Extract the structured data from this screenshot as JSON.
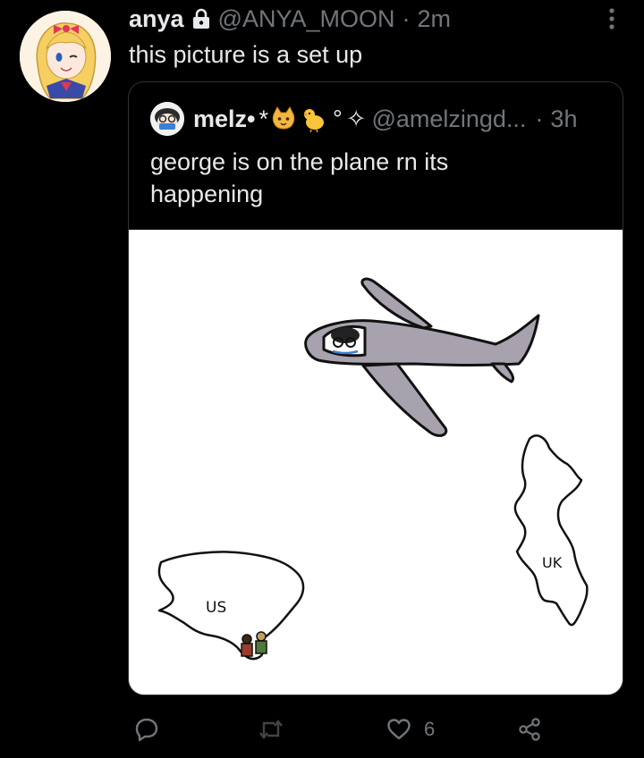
{
  "tweet": {
    "author_name": "anya",
    "author_handle": "@ANYA_MOON",
    "separator": "·",
    "timestamp": "2m",
    "text": "this picture is a set up"
  },
  "quoted_tweet": {
    "author_name": "melz•",
    "name_decoration_star": "*",
    "name_decoration_ring": "°",
    "name_decoration_sparkle": "✧",
    "author_handle": "@amelzingd...",
    "separator": "·",
    "timestamp": "3h",
    "text": "george is on the plane rn its happening",
    "image": {
      "label_us": "US",
      "label_uk": "UK"
    }
  },
  "actions": {
    "reply_icon": "reply-icon",
    "retweet_icon": "retweet-icon",
    "like_icon": "heart-icon",
    "like_count": "6",
    "share_icon": "share-icon"
  },
  "colors": {
    "background": "#000000",
    "text_primary": "#e7e9ea",
    "text_secondary": "#71767b",
    "border": "#2f3336",
    "plane_fill": "#a7a2ad"
  }
}
